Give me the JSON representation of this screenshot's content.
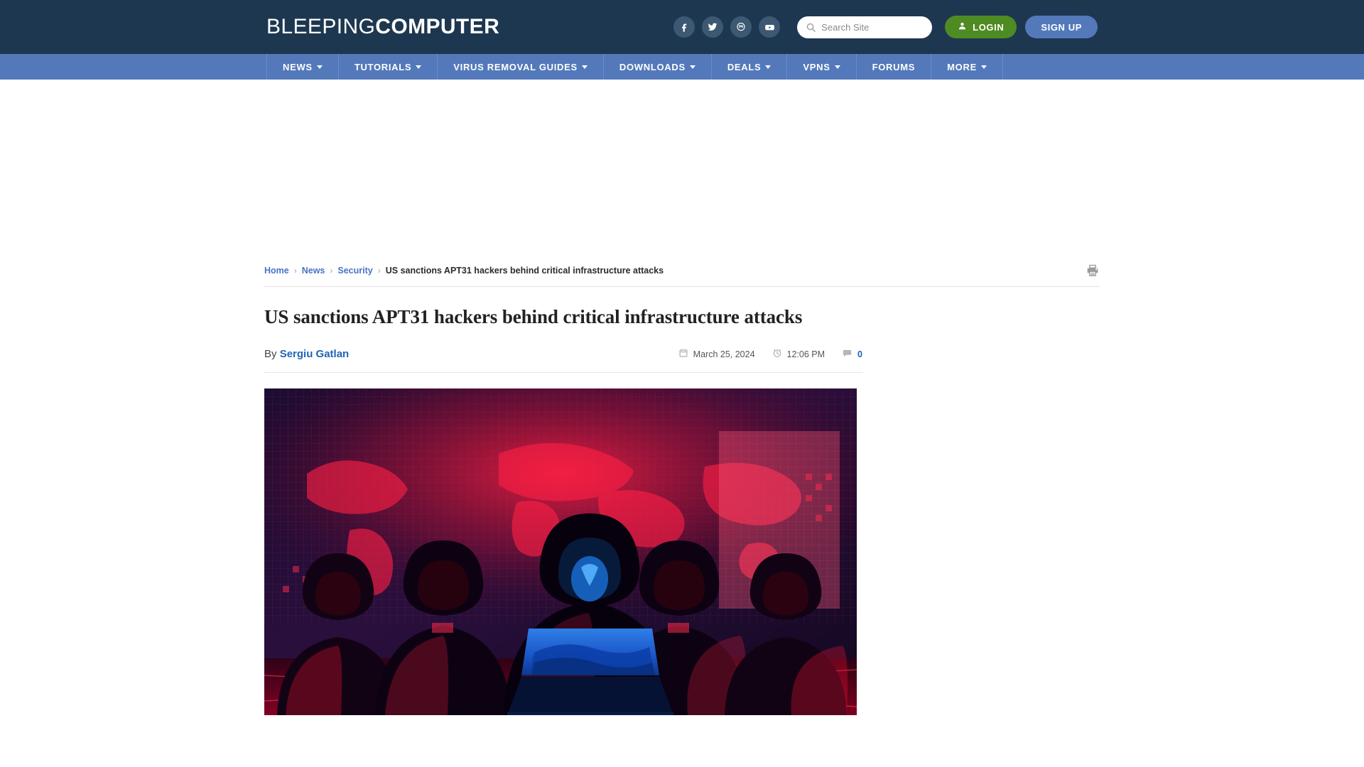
{
  "site": {
    "logo_light": "BLEEPING",
    "logo_bold": "COMPUTER"
  },
  "header": {
    "socials": [
      {
        "name": "facebook-icon",
        "label": "Facebook"
      },
      {
        "name": "twitter-icon",
        "label": "Twitter"
      },
      {
        "name": "mastodon-icon",
        "label": "Mastodon"
      },
      {
        "name": "youtube-icon",
        "label": "YouTube"
      }
    ],
    "search": {
      "placeholder": "Search Site",
      "value": ""
    },
    "login_label": "LOGIN",
    "signup_label": "SIGN UP",
    "colors": {
      "topbar_bg": "#1e3750",
      "nav_bg": "#5379bb",
      "login_bg": "#4e8b22",
      "signup_bg": "#5379bb"
    }
  },
  "nav": {
    "items": [
      {
        "label": "NEWS",
        "has_dropdown": true
      },
      {
        "label": "TUTORIALS",
        "has_dropdown": true
      },
      {
        "label": "VIRUS REMOVAL GUIDES",
        "has_dropdown": true
      },
      {
        "label": "DOWNLOADS",
        "has_dropdown": true
      },
      {
        "label": "DEALS",
        "has_dropdown": true
      },
      {
        "label": "VPNS",
        "has_dropdown": true
      },
      {
        "label": "FORUMS",
        "has_dropdown": false
      },
      {
        "label": "MORE",
        "has_dropdown": true
      }
    ]
  },
  "breadcrumb": {
    "home": "Home",
    "news": "News",
    "security": "Security",
    "current": "US sanctions APT31 hackers behind critical infrastructure attacks",
    "separator": "›"
  },
  "article": {
    "title": "US sanctions APT31 hackers behind critical infrastructure attacks",
    "by_label": "By",
    "author": "Sergiu Gatlan",
    "date": "March 25, 2024",
    "time": "12:06 PM",
    "comment_count": "0",
    "hero_alt": "Hooded hackers in front of a red world map with a glowing blue laptop"
  }
}
